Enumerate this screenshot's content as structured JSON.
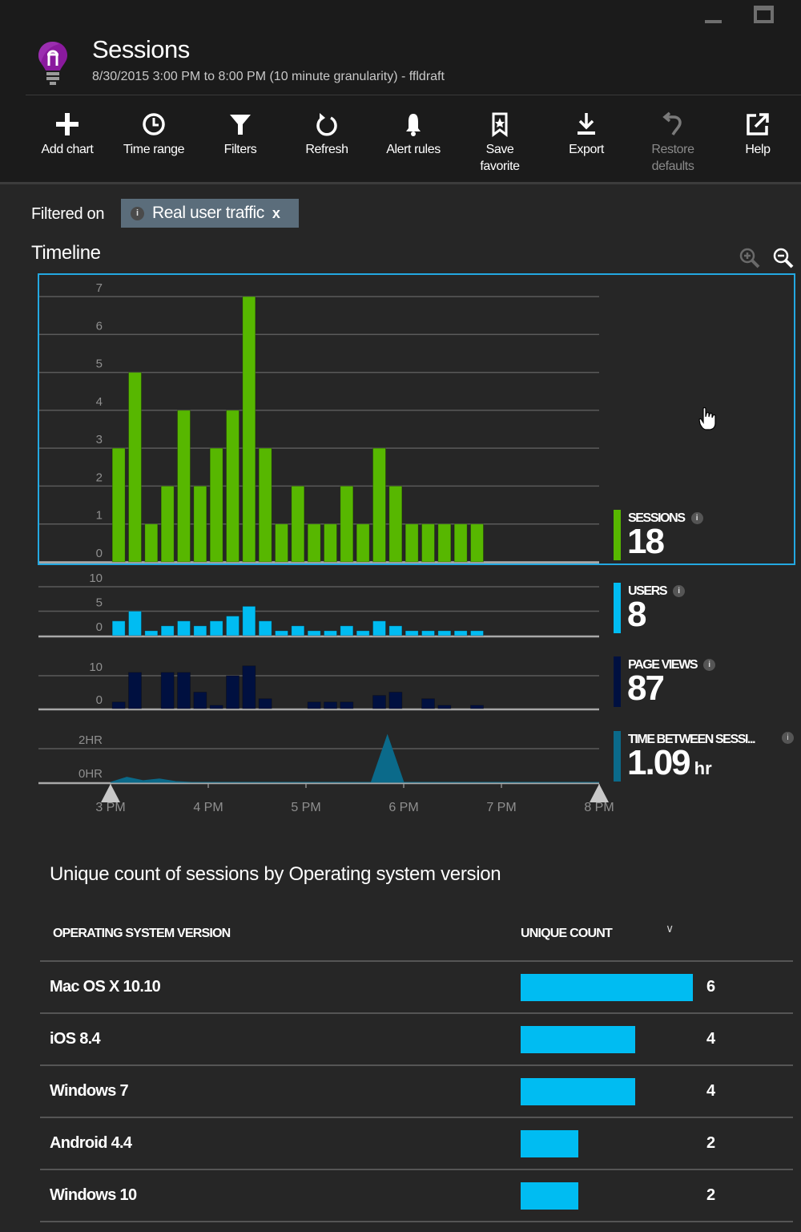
{
  "window": {
    "title": "Sessions",
    "subtitle": "8/30/2015 3:00 PM to 8:00 PM (10 minute granularity) - ffldraft"
  },
  "toolbar": {
    "buttons": [
      {
        "label_1": "Add chart",
        "label_2": "",
        "icon": "plus-icon",
        "enabled": true
      },
      {
        "label_1": "Time range",
        "label_2": "",
        "icon": "clock-icon",
        "enabled": true
      },
      {
        "label_1": "Filters",
        "label_2": "",
        "icon": "filter-icon",
        "enabled": true
      },
      {
        "label_1": "Refresh",
        "label_2": "",
        "icon": "refresh-icon",
        "enabled": true
      },
      {
        "label_1": "Alert rules",
        "label_2": "",
        "icon": "bell-icon",
        "enabled": true
      },
      {
        "label_1": "Save",
        "label_2": "favorite",
        "icon": "bookmark-star-icon",
        "enabled": true
      },
      {
        "label_1": "Export",
        "label_2": "",
        "icon": "download-icon",
        "enabled": true
      },
      {
        "label_1": "Restore",
        "label_2": "defaults",
        "icon": "undo-icon",
        "enabled": false
      },
      {
        "label_1": "Help",
        "label_2": "",
        "icon": "external-link-icon",
        "enabled": true
      }
    ]
  },
  "filter": {
    "label": "Filtered on",
    "chip_text": "Real user traffic",
    "info": "i",
    "remove": "x"
  },
  "timeline": {
    "title": "Timeline"
  },
  "metrics": [
    {
      "label": "SESSIONS",
      "value": "18",
      "unit": "",
      "color": "#57b700"
    },
    {
      "label": "USERS",
      "value": "8",
      "unit": "",
      "color": "#00bcf2"
    },
    {
      "label": "PAGE VIEWS",
      "value": "87",
      "unit": "",
      "color": "#001040"
    },
    {
      "label": "TIME BETWEEN SESSI...",
      "value": "1.09",
      "unit": "hr",
      "color": "#0b6a8a"
    }
  ],
  "chart_data": [
    {
      "type": "bar",
      "name": "Sessions",
      "color": "#57b700",
      "x_labels": [
        "3 PM",
        "4 PM",
        "5 PM",
        "6 PM",
        "7 PM",
        "8 PM"
      ],
      "x_range": [
        "15:00",
        "20:00"
      ],
      "granularity_minutes": 10,
      "y_ticks": [
        "0",
        "1",
        "2",
        "3",
        "4",
        "5",
        "6",
        "7"
      ],
      "ylim": [
        0,
        7
      ],
      "values": [
        3,
        5,
        1,
        2,
        4,
        2,
        3,
        4,
        7,
        3,
        1,
        2,
        1,
        1,
        2,
        1,
        3,
        2,
        1,
        1,
        1,
        1,
        1
      ]
    },
    {
      "type": "bar",
      "name": "Users",
      "color": "#00bcf2",
      "y_ticks": [
        "0",
        "5",
        "10"
      ],
      "ylim": [
        0,
        10
      ],
      "values": [
        3,
        5,
        1,
        2,
        3,
        2,
        3,
        4,
        6,
        3,
        1,
        2,
        1,
        1,
        2,
        1,
        3,
        2,
        1,
        1,
        1,
        1,
        1
      ]
    },
    {
      "type": "bar",
      "name": "Page views",
      "color": "#001040",
      "y_ticks": [
        "0",
        "10"
      ],
      "ylim": [
        0,
        10
      ],
      "values": [
        2,
        11,
        0,
        11,
        11,
        5,
        1,
        10,
        13,
        3,
        0,
        0,
        2,
        2,
        2,
        0,
        4,
        5,
        0,
        3,
        1,
        0,
        1
      ]
    },
    {
      "type": "area",
      "name": "Time between sessions",
      "color": "#0b6a8a",
      "y_ticks": [
        "0HR",
        "2HR"
      ],
      "ylim": [
        0,
        2
      ],
      "unit": "hr",
      "values": [
        0,
        0.3,
        0.1,
        0.2,
        0.05,
        0,
        0,
        0,
        0,
        0,
        0,
        0,
        0,
        0,
        0,
        0,
        0,
        2.8,
        0,
        0,
        0,
        0,
        0,
        0,
        0,
        0,
        0,
        0,
        0,
        0
      ]
    }
  ],
  "table": {
    "title": "Unique count of sessions by Operating system version",
    "columns": [
      "OPERATING SYSTEM VERSION",
      "UNIQUE COUNT"
    ],
    "sort_icon": "chevron-down-icon",
    "max": 6,
    "bar_color": "#00bcf2",
    "rows": [
      {
        "name": "Mac OS X 10.10",
        "count": 6
      },
      {
        "name": "iOS 8.4",
        "count": 4
      },
      {
        "name": "Windows 7",
        "count": 4
      },
      {
        "name": "Android 4.4",
        "count": 2
      },
      {
        "name": "Windows 10",
        "count": 2
      }
    ]
  }
}
